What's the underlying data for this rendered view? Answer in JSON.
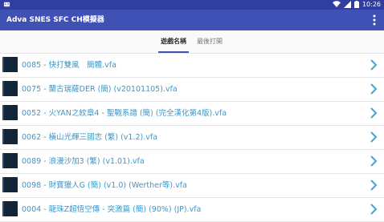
{
  "status_bar": {
    "time": "10:26",
    "icons": [
      "android-notification-icon",
      "wifi-icon",
      "cellular-signal-icon",
      "battery-icon"
    ]
  },
  "app_bar": {
    "title": "Adva SNES SFC CH模擬器",
    "menu_icon": "overflow-menu-icon"
  },
  "tabs": [
    {
      "label": "遊戲名稱",
      "active": true
    },
    {
      "label": "最後打開",
      "active": false
    }
  ],
  "games": [
    {
      "name": "0085 - 快打雙風　簡體.vfa"
    },
    {
      "name": "0075 - 蘭古瑞薩DER (簡) (v20101105).vfa"
    },
    {
      "name": "0052 - 火YAN之紋章4 - 聖戰系譜 (簡) (完全漢化第4版).vfa"
    },
    {
      "name": "0062 - 橫山光輝三國志 (繁) (v1.2).vfa"
    },
    {
      "name": "0089 - 浪漫沙加3 (繁) (v1.01).vfa"
    },
    {
      "name": "0098 - 財寶獵人G (簡) (v1.0) (Werther等).vfa"
    },
    {
      "name": "0004 - 龍珠Z超悟空傳 - 突激篇 (簡) (90%) (JP).vfa"
    }
  ],
  "colors": {
    "status_bar": "#303f9f",
    "app_bar": "#3f51b5",
    "list_text": "#3d97c7",
    "chevron": "#4aa0d0",
    "thumbnail": "#132538"
  }
}
